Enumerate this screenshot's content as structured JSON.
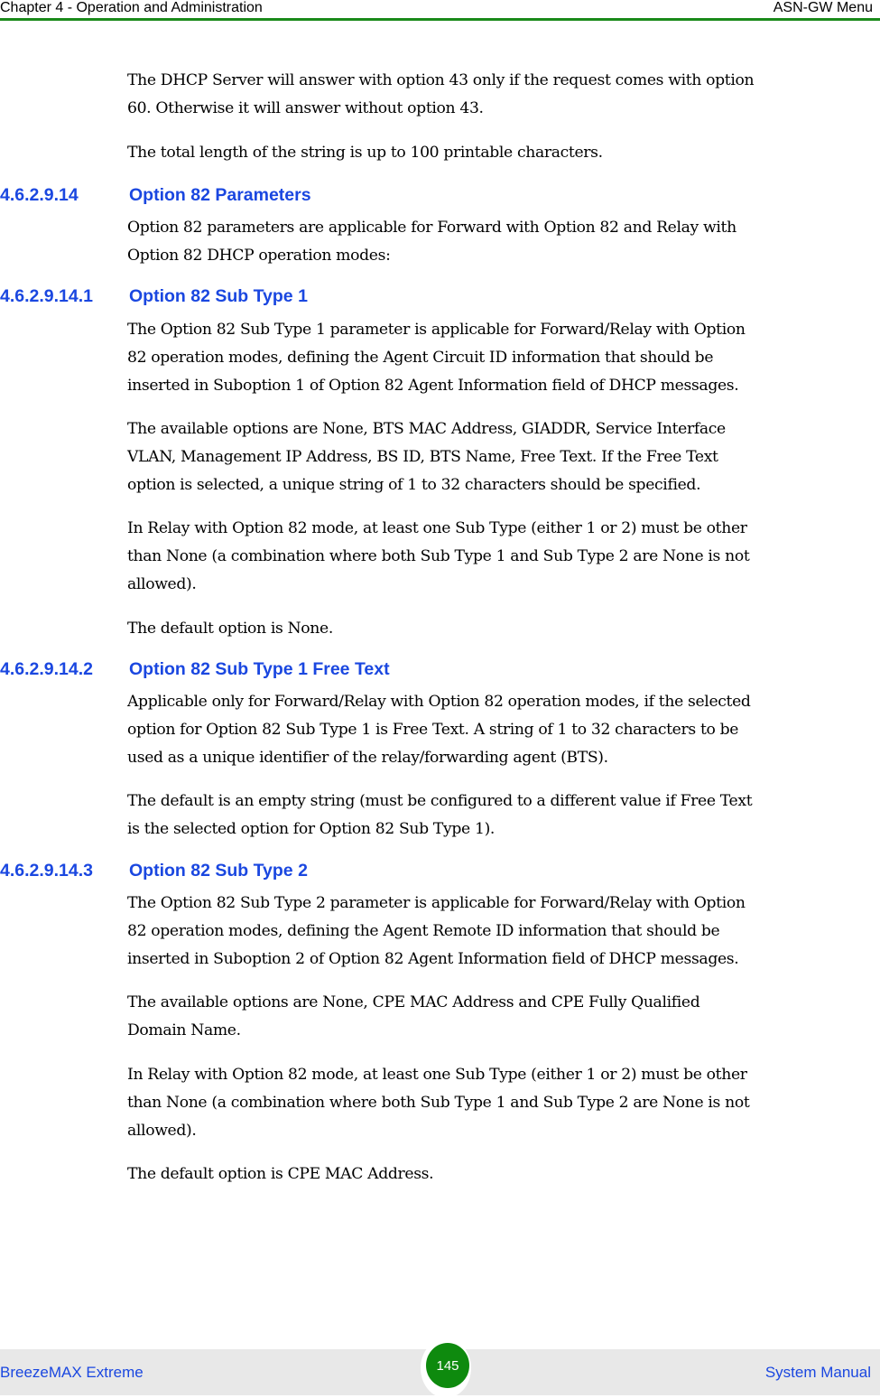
{
  "header": {
    "chapter": "Chapter 4 - Operation and Administration",
    "section": "ASN-GW Menu",
    "rule_color": "#1a8a1a"
  },
  "intro": {
    "p1_line1": "The DHCP Server will answer with option 43 only if the request comes with option",
    "p1_line2": "60. Otherwise it will answer without option 43.",
    "p2": "The total length of the string is up to 100 printable characters."
  },
  "sections": [
    {
      "number": "4.6.2.9.14",
      "title": "Option 82 Parameters",
      "paragraphs": [
        [
          "Option 82 parameters are applicable for Forward with Option 82 and Relay with",
          "Option 82 DHCP operation modes:"
        ]
      ]
    },
    {
      "number": "4.6.2.9.14.1",
      "title": "Option 82 Sub Type 1",
      "paragraphs": [
        [
          "The Option 82 Sub Type 1 parameter is applicable for Forward/Relay with Option",
          "82 operation modes, defining the Agent Circuit ID information that should be",
          "inserted in Suboption 1 of Option 82 Agent Information field of DHCP messages."
        ],
        [
          "The available options are None, BTS MAC Address, GIADDR, Service Interface",
          "VLAN, Management IP Address, BS ID, BTS Name, Free Text. If the Free Text",
          "option is selected, a unique string of 1 to 32 characters should be specified."
        ],
        [
          "In Relay with Option 82 mode, at least one Sub Type (either 1 or 2) must be other",
          "than None (a combination where both Sub Type 1 and Sub Type 2 are None is not",
          "allowed)."
        ],
        [
          "The default option is None."
        ]
      ]
    },
    {
      "number": "4.6.2.9.14.2",
      "title": "Option 82 Sub Type 1 Free Text",
      "paragraphs": [
        [
          "Applicable only for Forward/Relay with Option 82 operation modes, if the selected",
          "option for Option 82 Sub Type 1 is Free Text. A string of 1 to 32 characters to be",
          "used as a unique identifier of the relay/forwarding agent (BTS)."
        ],
        [
          "The default is an empty string (must be configured to a different value if Free Text",
          "is the selected option for Option 82 Sub Type 1)."
        ]
      ]
    },
    {
      "number": "4.6.2.9.14.3",
      "title": "Option 82 Sub Type 2",
      "paragraphs": [
        [
          "The Option 82 Sub Type 2 parameter is applicable for Forward/Relay with Option",
          "82 operation modes, defining the Agent Remote ID information that should be",
          "inserted in Suboption 2 of Option 82 Agent Information field of DHCP messages."
        ],
        [
          "The available options are None, CPE MAC Address and CPE Fully Qualified",
          "Domain Name."
        ],
        [
          "In Relay with Option 82 mode, at least one Sub Type (either 1 or 2) must be other",
          "than None (a combination where both Sub Type 1 and Sub Type 2 are None is not",
          "allowed)."
        ],
        [
          "The default option is CPE MAC Address."
        ]
      ]
    }
  ],
  "footer": {
    "product": "BreezeMAX Extreme",
    "page_number": "145",
    "doc_type": "System Manual",
    "badge_color": "#0e8a0e",
    "text_color": "#1a47e0"
  }
}
